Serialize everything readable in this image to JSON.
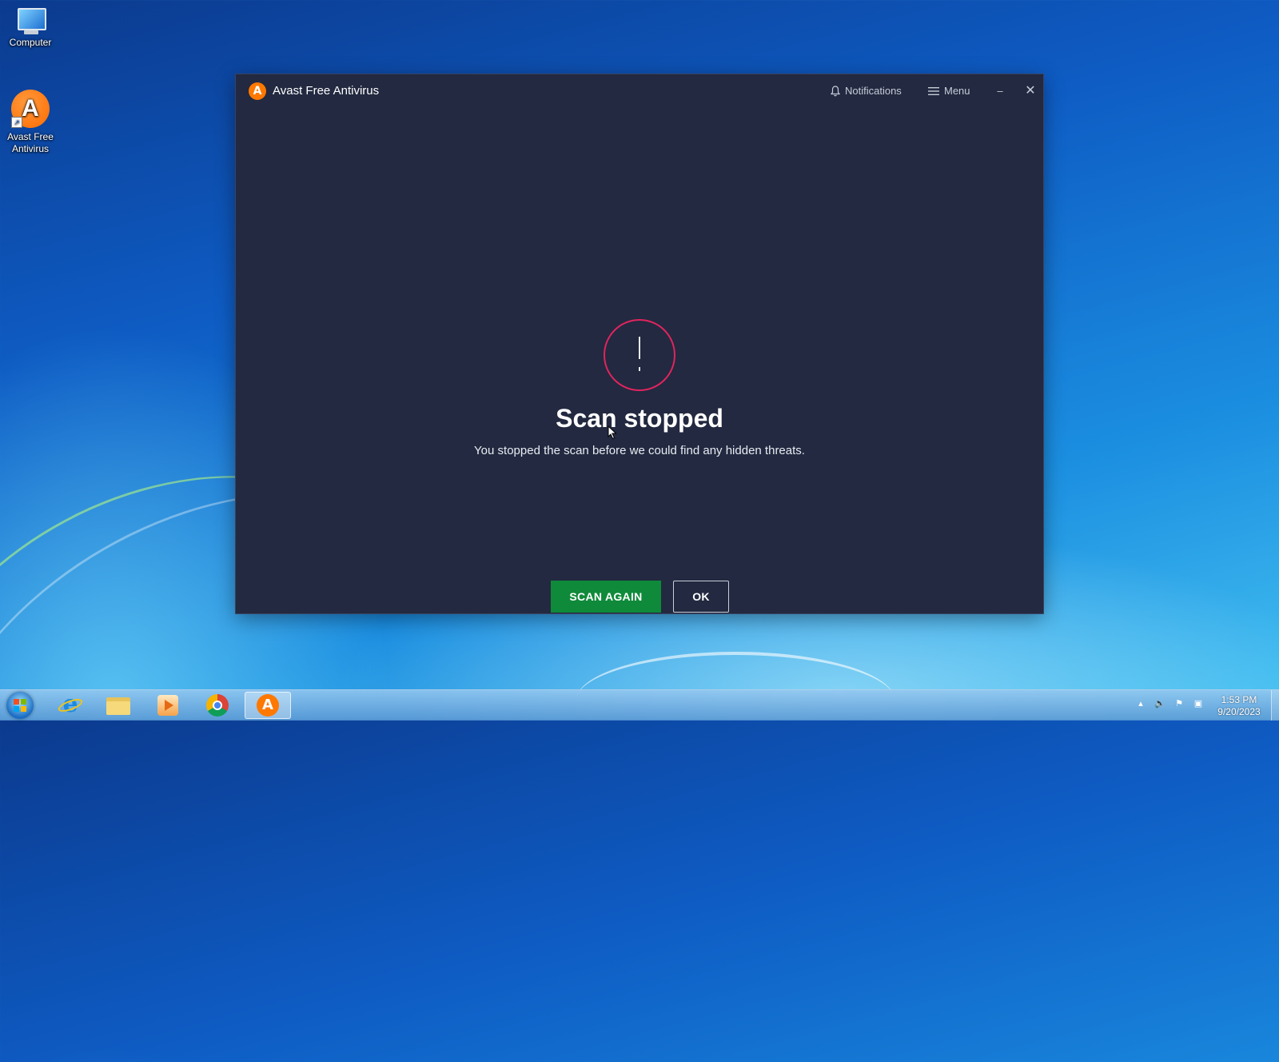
{
  "desktop": {
    "icons": [
      {
        "label": "Computer",
        "icon": "computer-icon"
      },
      {
        "label": "Avast Free\nAntivirus",
        "label_line1": "Avast Free",
        "label_line2": "Antivirus",
        "icon": "avast-icon"
      }
    ]
  },
  "window": {
    "title": "Avast Free Antivirus",
    "notifications_label": "Notifications",
    "menu_label": "Menu",
    "minimize_glyph": "–",
    "close_glyph": "✕"
  },
  "result": {
    "icon": "alert-circle-icon",
    "headline": "Scan stopped",
    "message": "You stopped the scan before we could find any hidden threats.",
    "primary_button": "SCAN AGAIN",
    "secondary_button": "OK",
    "accent_color": "#e0245e",
    "primary_color": "#0f8a3a"
  },
  "taskbar": {
    "apps": [
      "start-button",
      "internet-explorer-icon",
      "file-explorer-icon",
      "media-player-icon",
      "chrome-icon",
      "avast-icon"
    ],
    "time": "1:53 PM",
    "date": "9/20/2023"
  }
}
